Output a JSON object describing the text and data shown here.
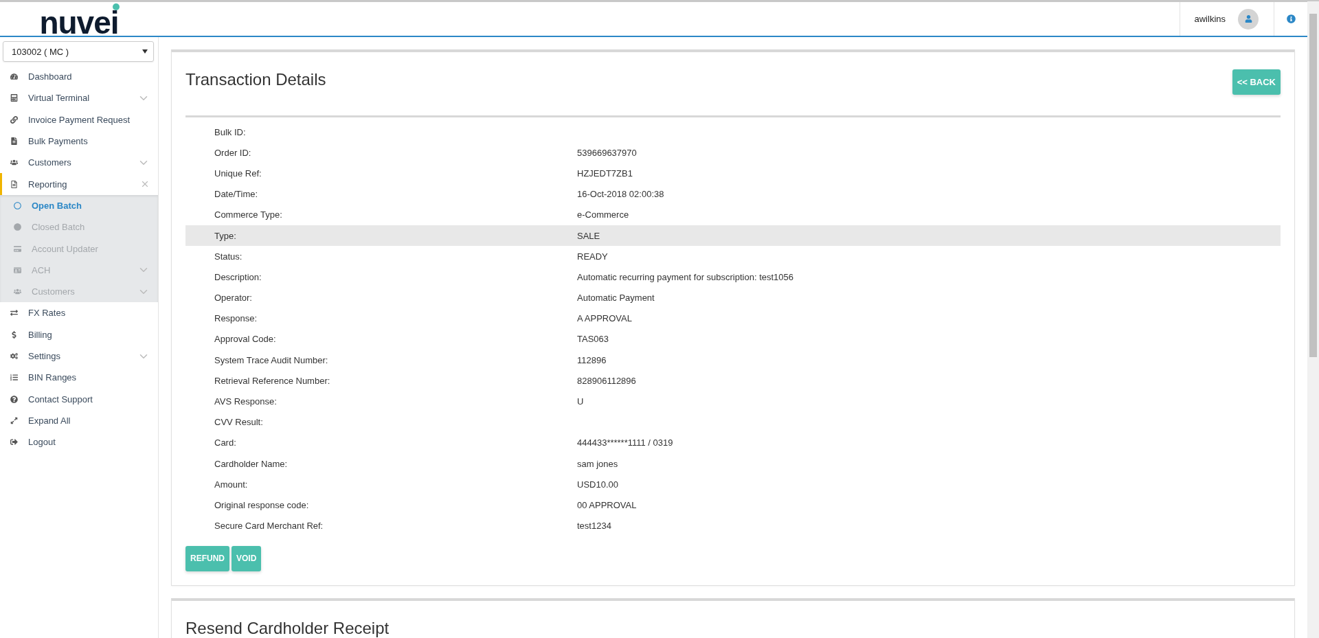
{
  "header": {
    "logo": "nuvei",
    "username": "awilkins"
  },
  "sidebar": {
    "merchant_select": "103002 ( MC )",
    "items": [
      {
        "label": "Dashboard",
        "expandable": false,
        "expanded": false
      },
      {
        "label": "Virtual Terminal",
        "expandable": true,
        "expanded": false
      },
      {
        "label": "Invoice Payment Request",
        "expandable": false,
        "expanded": false
      },
      {
        "label": "Bulk Payments",
        "expandable": false,
        "expanded": false
      },
      {
        "label": "Customers",
        "expandable": true,
        "expanded": false
      },
      {
        "label": "Reporting",
        "expandable": true,
        "expanded": true,
        "children": [
          {
            "label": "Open Batch",
            "selected": true,
            "expandable": false
          },
          {
            "label": "Closed Batch",
            "selected": false,
            "expandable": false
          },
          {
            "label": "Account Updater",
            "selected": false,
            "expandable": false
          },
          {
            "label": "ACH",
            "selected": false,
            "expandable": true
          },
          {
            "label": "Customers",
            "selected": false,
            "expandable": true
          }
        ]
      },
      {
        "label": "FX Rates",
        "expandable": false,
        "expanded": false
      },
      {
        "label": "Billing",
        "expandable": false,
        "expanded": false
      },
      {
        "label": "Settings",
        "expandable": true,
        "expanded": false
      },
      {
        "label": "BIN Ranges",
        "expandable": false,
        "expanded": false
      },
      {
        "label": "Contact Support",
        "expandable": false,
        "expanded": false
      },
      {
        "label": "Expand All",
        "expandable": false,
        "expanded": false
      },
      {
        "label": "Logout",
        "expandable": false,
        "expanded": false
      }
    ]
  },
  "transaction_details": {
    "title": "Transaction Details",
    "back_button": "<< BACK",
    "rows": [
      {
        "label": "Bulk ID:",
        "value": "",
        "selected": false
      },
      {
        "label": "Order ID:",
        "value": "539669637970",
        "selected": false
      },
      {
        "label": "Unique Ref:",
        "value": "HZJEDT7ZB1",
        "selected": false
      },
      {
        "label": "Date/Time:",
        "value": "16-Oct-2018 02:00:38",
        "selected": false
      },
      {
        "label": "Commerce Type:",
        "value": "e-Commerce",
        "selected": false
      },
      {
        "label": "Type:",
        "value": "SALE",
        "selected": true
      },
      {
        "label": "Status:",
        "value": "READY",
        "selected": false
      },
      {
        "label": "Description:",
        "value": "Automatic recurring payment for subscription: test1056",
        "selected": false
      },
      {
        "label": "Operator:",
        "value": "Automatic Payment",
        "selected": false
      },
      {
        "label": "Response:",
        "value": "A APPROVAL",
        "selected": false
      },
      {
        "label": "Approval Code:",
        "value": "TAS063",
        "selected": false
      },
      {
        "label": "System Trace Audit Number:",
        "value": "112896",
        "selected": false
      },
      {
        "label": "Retrieval Reference Number:",
        "value": "828906112896",
        "selected": false
      },
      {
        "label": "AVS Response:",
        "value": "U",
        "selected": false
      },
      {
        "label": "CVV Result:",
        "value": "",
        "selected": false
      },
      {
        "label": "Card:",
        "value": "444433******1111 / 0319",
        "selected": false
      },
      {
        "label": "Cardholder Name:",
        "value": "sam jones",
        "selected": false
      },
      {
        "label": "Amount:",
        "value": "USD10.00",
        "selected": false
      },
      {
        "label": "Original response code:",
        "value": "00 APPROVAL",
        "selected": false
      },
      {
        "label": "Secure Card Merchant Ref:",
        "value": "test1234",
        "selected": false
      }
    ],
    "buttons": [
      "REFUND",
      "VOID"
    ]
  },
  "resend_receipt": {
    "title": "Resend Cardholder Receipt"
  }
}
